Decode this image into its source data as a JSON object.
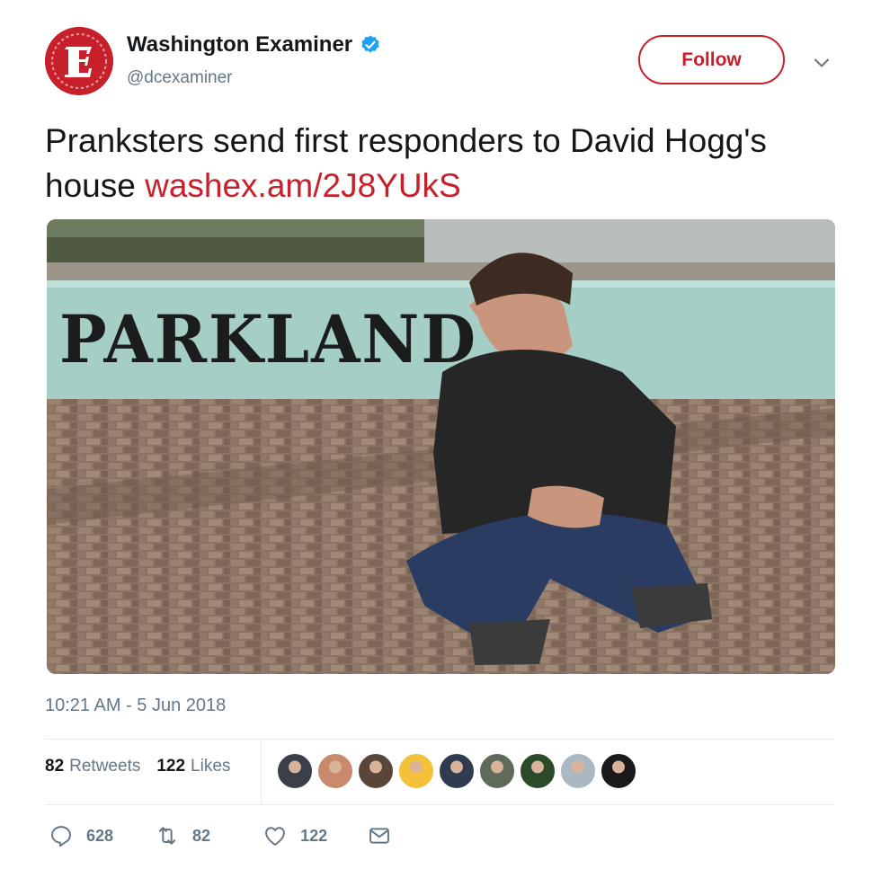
{
  "account": {
    "display_name": "Washington Examiner",
    "handle": "@dcexaminer",
    "verified": true,
    "avatar_icon": "washington-examiner-logo-icon",
    "brand_color": "#c8202b"
  },
  "header": {
    "follow_label": "Follow",
    "menu_icon": "chevron-down-icon"
  },
  "tweet": {
    "text": "Pranksters send first responders to David Hogg's house",
    "link": "washex.am/2J8YUkS",
    "media_icon": "photo-parkland-sign",
    "media_sign_text": "PARKLAND",
    "timestamp": "10:21 AM - 5 Jun 2018"
  },
  "stats": {
    "retweets_count": "82",
    "retweets_label": "Retweets",
    "likes_count": "122",
    "likes_label": "Likes",
    "liker_avatars": [
      "#3a3f4a",
      "#c98a6c",
      "#5a4638",
      "#f3c23a",
      "#2f3c50",
      "#5f6a58",
      "#2a4a2a",
      "#aab8c2",
      "#1a1a1a"
    ]
  },
  "actions": {
    "reply_count": "628",
    "retweet_count": "82",
    "like_count": "122",
    "reply_icon": "reply-icon",
    "retweet_icon": "retweet-icon",
    "like_icon": "heart-icon",
    "dm_icon": "envelope-icon",
    "icon_color": "#657786"
  }
}
